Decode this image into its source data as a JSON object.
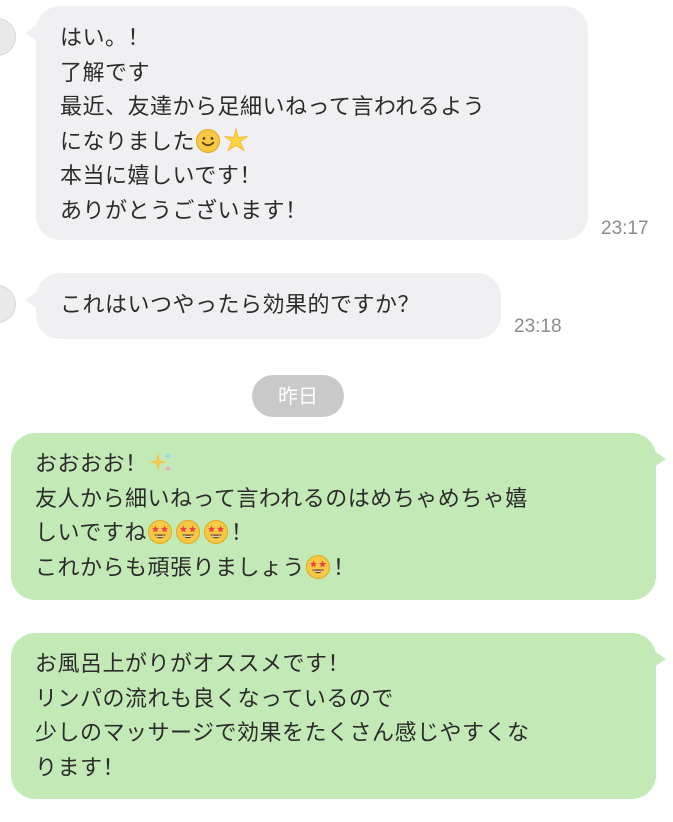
{
  "messages_received": [
    {
      "lines": [
        "はい。！",
        "了解です",
        "最近、友達から足細いねって言われるよう"
      ],
      "line4_text": "になりました",
      "lines_after": [
        "本当に嬉しいです！",
        "ありがとうございます！"
      ],
      "emojis": [
        "smiling-face-icon",
        "glowing-star-icon"
      ],
      "time": "23:17"
    },
    {
      "text": "これはいつやったら効果的ですか？",
      "time": "23:18"
    }
  ],
  "date_separator": "昨日",
  "messages_sent": [
    {
      "line1": "おおおお！",
      "line2": "友人から細いねって言われるのはめちゃめちゃ嬉",
      "line3_text": "しいですね",
      "line3_suffix": "！",
      "line4_text": "これからも頑張りましょう",
      "line4_suffix": "！",
      "emojis": [
        "sparkles-icon",
        "star-struck-icon"
      ]
    },
    {
      "lines": [
        "お風呂上がりがオススメです！",
        "リンパの流れも良くなっているので",
        "少しのマッサージで効果をたくさん感じやすくな",
        "ります！"
      ]
    }
  ],
  "colors": {
    "received_bubble": "#f0f0f3",
    "sent_bubble": "#c3e9b7",
    "date_pill": "#c9c9c9",
    "timestamp": "#8c8c8c"
  }
}
